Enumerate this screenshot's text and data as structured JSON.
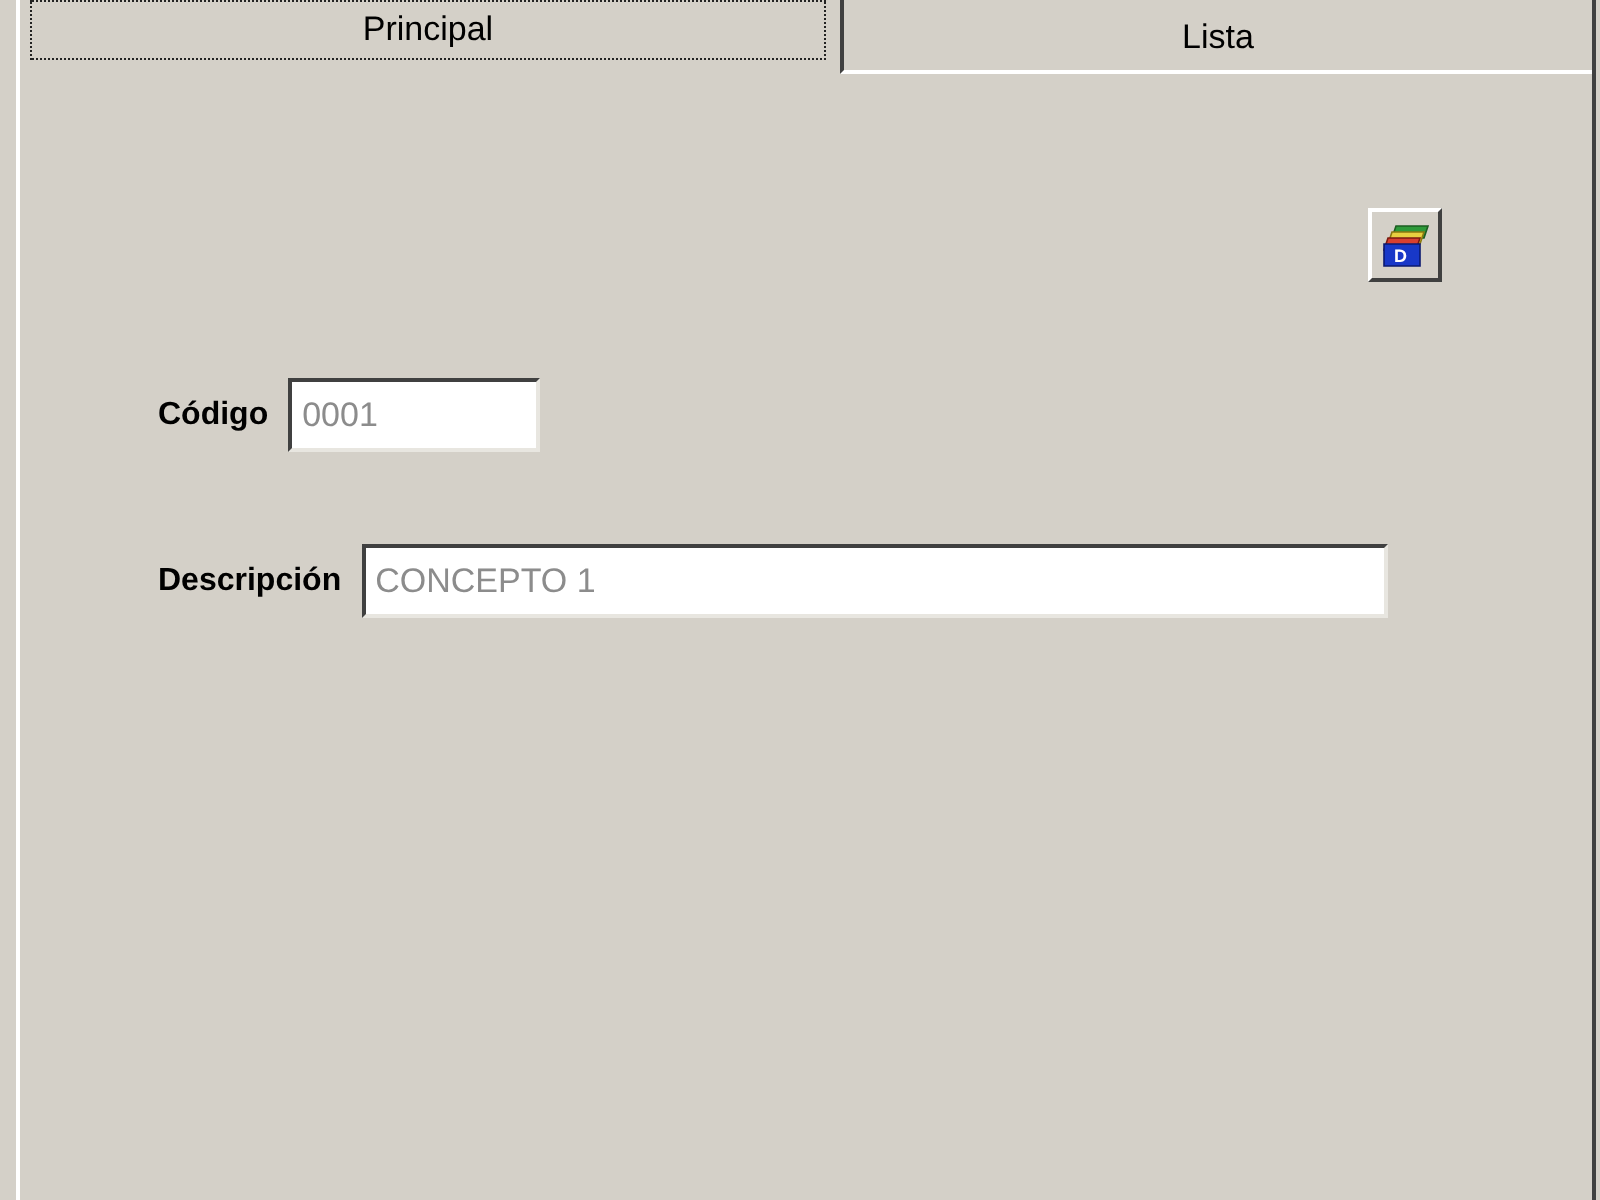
{
  "tabs": [
    {
      "label": "Principal",
      "selected": true
    },
    {
      "label": "Lista",
      "selected": false
    }
  ],
  "toolbar_button": {
    "icon_letter": "D"
  },
  "fields": [
    {
      "label": "Código",
      "value": "0001",
      "disabled": true
    },
    {
      "label": "Descripción",
      "value": "CONCEPTO 1",
      "disabled": true
    }
  ]
}
